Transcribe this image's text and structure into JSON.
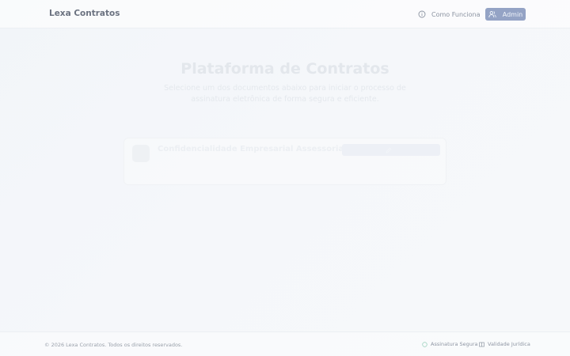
{
  "header": {
    "brand": "Lexa Contratos",
    "how_it_works": "Como Funciona",
    "admin": "Admin"
  },
  "hero": {
    "title": "Plataforma de Contratos",
    "subtitle": "Selecione um dos documentos abaixo para iniciar o processo de assinatura eletrônica de forma segura e eficiente."
  },
  "documents": [
    {
      "title": "Confidencialidade Empresarial Assessoria",
      "description": "",
      "button": ""
    }
  ],
  "footer": {
    "copyright": "© 2026 Lexa Contratos. Todos os direitos reservados.",
    "secure": "Assinatura Segura",
    "legal": "Validade Jurídica"
  },
  "colors": {
    "accent": "#94a3c5",
    "text_muted": "#8b93a1"
  },
  "icons": {
    "how_it_works": "info-circle-icon",
    "admin": "users-icon",
    "secure": "shield-icon",
    "legal": "book-icon",
    "document": "document-icon"
  }
}
